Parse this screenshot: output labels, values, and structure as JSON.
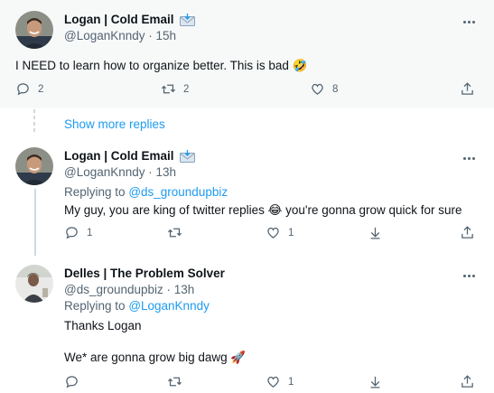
{
  "tweets": [
    {
      "name": "Logan | Cold Email",
      "handle": "@LoganKnndy",
      "time": "15h",
      "text": "I NEED to learn how to organize better. This is bad 🤣",
      "replies": "2",
      "retweets": "2",
      "likes": "8"
    },
    {
      "name": "Logan | Cold Email",
      "handle": "@LoganKnndy",
      "time": "13h",
      "replying_label": "Replying to",
      "replying_to": "@ds_groundupbiz",
      "text": "My guy, you are king of twitter replies 😂 you're gonna grow quick for sure",
      "replies": "1",
      "retweets": "",
      "likes": "1"
    },
    {
      "name": "Delles | The Problem Solver",
      "handle": "@ds_groundupbiz",
      "time": "13h",
      "replying_label": "Replying to",
      "replying_to": "@LoganKnndy",
      "text_line1": "Thanks Logan",
      "text_line2": "We* are gonna grow big dawg 🚀",
      "replies": "",
      "retweets": "",
      "likes": "1"
    }
  ],
  "show_more_replies": "Show more replies",
  "colors": {
    "accent": "#1d9bf0",
    "muted": "#536471",
    "text": "#0f1419",
    "highlight_bg": "#f7f9f9"
  }
}
